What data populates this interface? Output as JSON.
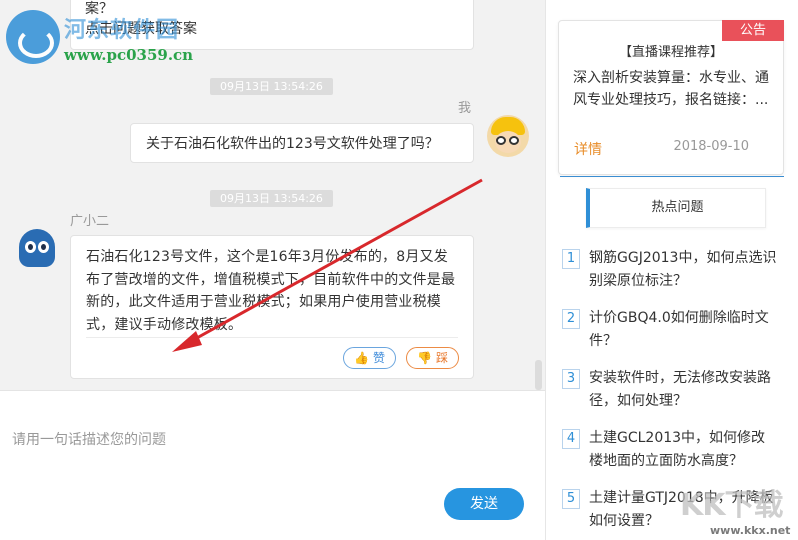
{
  "watermark": {
    "logo_name": "河东软件园",
    "logo_url": "www.pc0359.cn",
    "corner_brand": "KK下载",
    "corner_url": "www.kkx.net"
  },
  "chat": {
    "messages": [
      {
        "sender": "bot",
        "text": "案？\n点击问题获取答案"
      },
      {
        "timestamp": "09月13日 13:54:26"
      },
      {
        "sender": "me",
        "label": "我",
        "text": "关于石油石化软件出的123号文软件处理了吗？"
      },
      {
        "timestamp": "09月13日 13:54:26"
      },
      {
        "sender": "bot",
        "label": "广小二",
        "text": "石油石化123号文件，这个是16年3月份发布的，8月又发布了营改增的文件，增值税模式下，目前软件中的文件是最新的，此文件适用于营业税模式；如果用户使用营业税模式，建议手动修改模板。",
        "like_label": "赞",
        "dislike_label": "踩"
      }
    ]
  },
  "input": {
    "placeholder": "请用一句话描述您的问题",
    "send_label": "发送"
  },
  "notice": {
    "tag": "公告",
    "title": "【直播课程推荐】",
    "body": "深入剖析安装算量：水专业、通风专业处理技巧，报名链接：...",
    "more_label": "详情",
    "date": "2018-09-10"
  },
  "hot": {
    "header": "热点问题",
    "items": [
      {
        "num": "1",
        "text": "钢筋GGJ2013中，如何点选识别梁原位标注？"
      },
      {
        "num": "2",
        "text": "计价GBQ4.0如何删除临时文件？"
      },
      {
        "num": "3",
        "text": "安装软件时，无法修改安装路径，如何处理？"
      },
      {
        "num": "4",
        "text": "土建GCL2013中，如何修改楼地面的立面防水高度？"
      },
      {
        "num": "5",
        "text": "土建计量GTJ2018中，升降板如何设置？"
      }
    ]
  },
  "colors": {
    "accent": "#2795e0",
    "notice_tag": "#e9515a",
    "detail_link": "#e88d2a",
    "annotation_arrow": "#d8282c"
  }
}
